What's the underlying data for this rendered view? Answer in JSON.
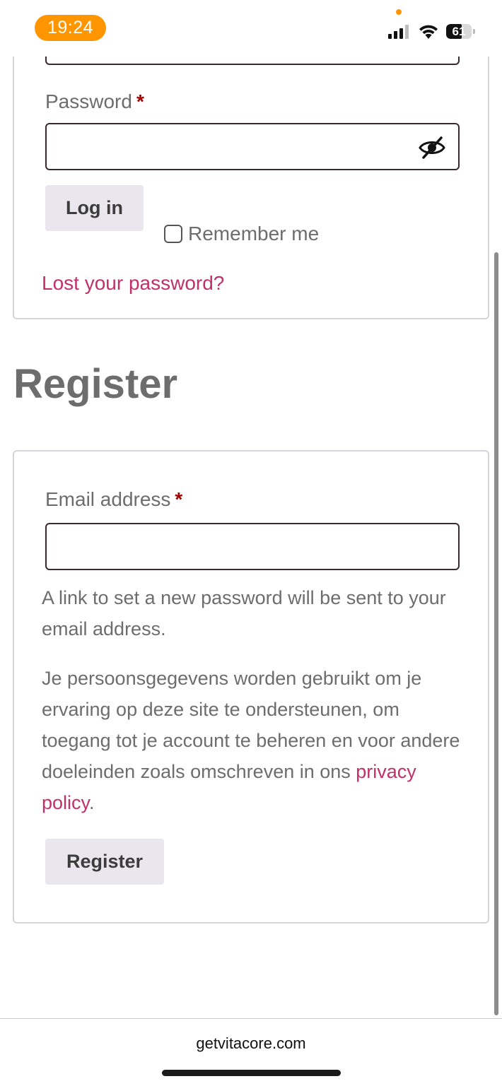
{
  "status_bar": {
    "time": "19:24",
    "battery_level": "61",
    "battery_fraction": 0.61,
    "accent_color": "#ff9500"
  },
  "login": {
    "password_label": "Password",
    "required_marker": "*",
    "password_value": "",
    "toggle_visibility_icon": "eye-slash-icon",
    "login_button": "Log in",
    "remember_me_label": "Remember me",
    "remember_me_checked": false,
    "lost_password_link": "Lost your password?"
  },
  "register": {
    "heading": "Register",
    "email_label": "Email address",
    "required_marker": "*",
    "email_value": "",
    "info_text": "A link to set a new password will be sent to your email address.",
    "privacy_text": "Je persoonsgegevens worden gebruikt om je ervaring op deze site te ondersteunen, om toegang tot je account te beheren en voor andere doeleinden zoals omschreven in ons ",
    "privacy_link": "privacy policy",
    "privacy_period": ".",
    "register_button": "Register"
  },
  "browser": {
    "url": "getvitacore.com"
  },
  "colors": {
    "link": "#c2306a",
    "required": "#a30000",
    "button_bg": "#e9e6ed"
  }
}
